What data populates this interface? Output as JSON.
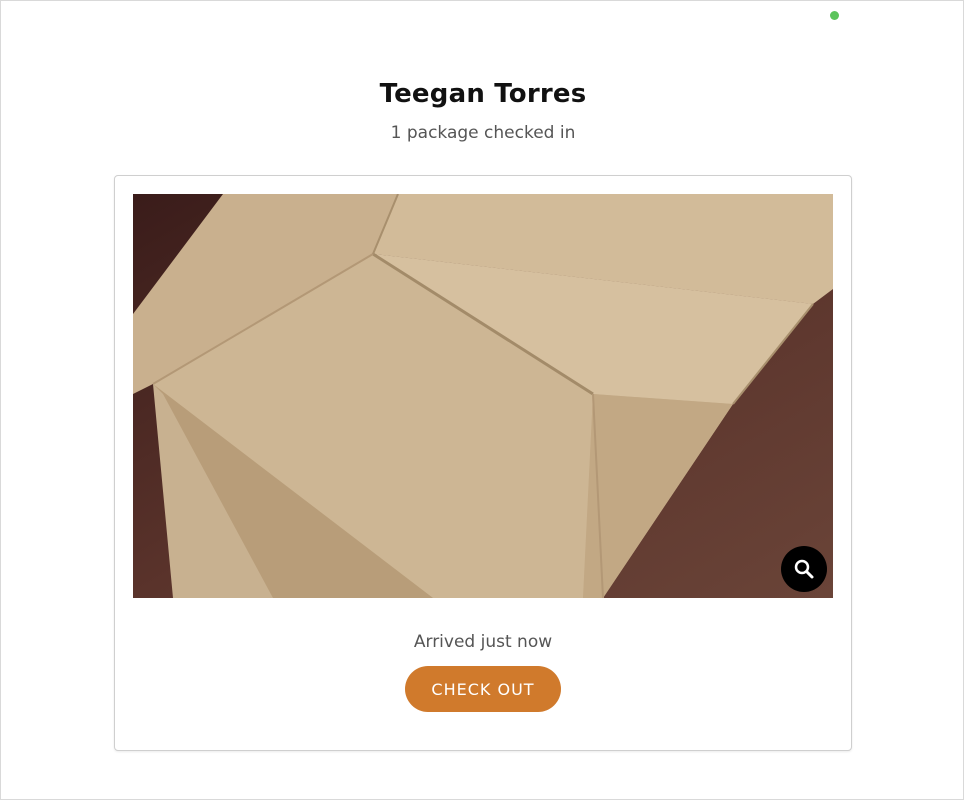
{
  "header": {
    "recipient_name": "Teegan Torres",
    "package_summary": "1 package checked in"
  },
  "status": {
    "indicator_color": "#5cc45c",
    "indicator_icon": "online-status-dot"
  },
  "package_card": {
    "photo_subject": "cardboard box",
    "zoom_icon": "magnifier-icon",
    "arrival_text": "Arrived just now",
    "checkout_label": "CHECK OUT",
    "checkout_color": "#d07a2c"
  }
}
